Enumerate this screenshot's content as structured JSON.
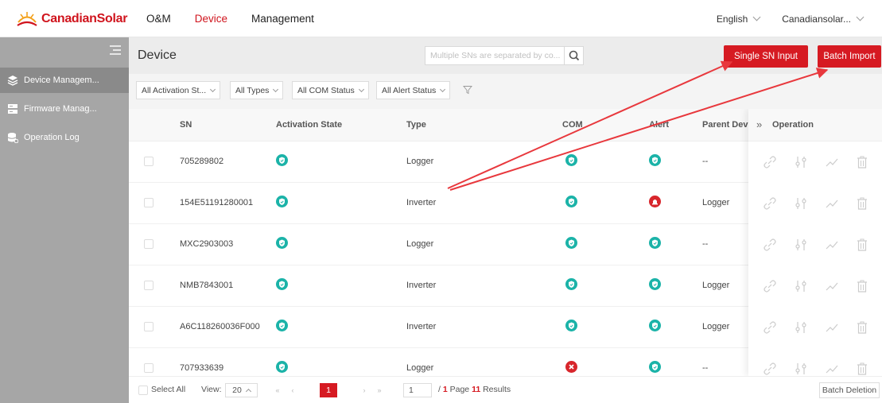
{
  "brand": {
    "name": "CanadianSolar",
    "color": "#d0141d"
  },
  "topnav": [
    {
      "label": "O&M",
      "active": false
    },
    {
      "label": "Device",
      "active": true
    },
    {
      "label": "Management",
      "active": false
    }
  ],
  "top_right": {
    "language": "English",
    "account": "Canadiansolar..."
  },
  "sidebar": {
    "items": [
      {
        "label": "Device Managem...",
        "icon": "layers-icon",
        "active": true
      },
      {
        "label": "Firmware Manag...",
        "icon": "server-icon",
        "active": false
      },
      {
        "label": "Operation Log",
        "icon": "database-icon",
        "active": false
      }
    ]
  },
  "page": {
    "title": "Device",
    "search_placeholder": "Multiple SNs are separated by co...",
    "single_btn": "Single SN Input",
    "batch_btn": "Batch Import"
  },
  "filters": [
    "All Activation St...",
    "All Types",
    "All COM Status",
    "All Alert Status"
  ],
  "table": {
    "columns": [
      "SN",
      "Activation State",
      "Type",
      "COM",
      "Alert",
      "Parent Devi",
      "Operation"
    ],
    "rows": [
      {
        "sn": "705289802",
        "type": "Logger",
        "com": "ok",
        "alert": "ok",
        "parent": "--"
      },
      {
        "sn": "154E51191280001",
        "type": "Inverter",
        "com": "ok",
        "alert": "alarm",
        "parent": "Logger"
      },
      {
        "sn": "MXC2903003",
        "type": "Logger",
        "com": "ok",
        "alert": "ok",
        "parent": "--"
      },
      {
        "sn": "NMB7843001",
        "type": "Inverter",
        "com": "ok",
        "alert": "ok",
        "parent": "Logger"
      },
      {
        "sn": "A6C118260036F000",
        "type": "Inverter",
        "com": "ok",
        "alert": "ok",
        "parent": "Logger"
      },
      {
        "sn": "707933639",
        "type": "Logger",
        "com": "error",
        "alert": "ok",
        "parent": "--"
      }
    ]
  },
  "footer": {
    "select_all": "Select All",
    "view_label": "View:",
    "page_size": "20",
    "current_page": "1",
    "page_input": "1",
    "page_of": "/",
    "total_pages": "1",
    "page_word": "Page",
    "results_count": "11",
    "results_word": "Results",
    "batch_delete": "Batch Deletion"
  },
  "colors": {
    "accent": "#d61a22",
    "ok": "#1bb3a8",
    "alarm": "#d8262c",
    "sidebar": "#a6a6a6"
  }
}
